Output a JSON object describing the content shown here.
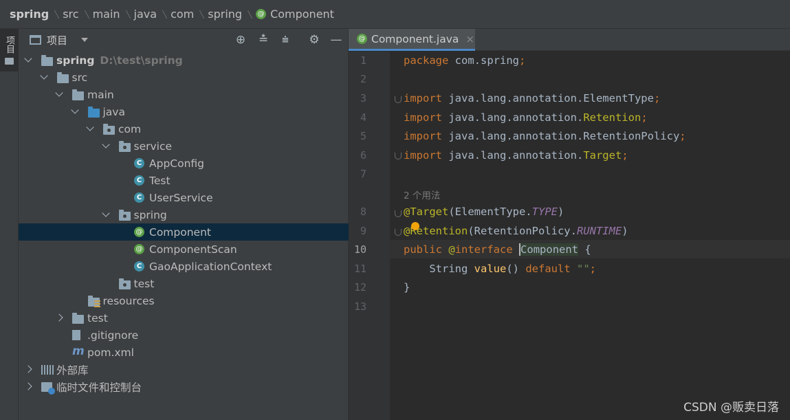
{
  "breadcrumb": [
    {
      "label": "spring",
      "bold": true
    },
    {
      "label": "src"
    },
    {
      "label": "main"
    },
    {
      "label": "java"
    },
    {
      "label": "com"
    },
    {
      "label": "spring"
    },
    {
      "label": "Component",
      "icon": "annotation-icon"
    }
  ],
  "left_strip": {
    "project_tab": "项目"
  },
  "panel": {
    "title": "项目",
    "toolbar": [
      "locate-icon",
      "expand-all-icon",
      "collapse-all-icon",
      "gear-icon",
      "hide-icon"
    ]
  },
  "tree": [
    {
      "label": "spring",
      "path": "D:\\test\\spring",
      "depth": 0,
      "arrow": "down",
      "icon": "module-folder-icon",
      "bold": true
    },
    {
      "label": "src",
      "depth": 1,
      "arrow": "down",
      "icon": "folder-icon"
    },
    {
      "label": "main",
      "depth": 2,
      "arrow": "down",
      "icon": "folder-icon"
    },
    {
      "label": "java",
      "depth": 3,
      "arrow": "down",
      "icon": "source-folder-icon"
    },
    {
      "label": "com",
      "depth": 4,
      "arrow": "down",
      "icon": "package-icon"
    },
    {
      "label": "service",
      "depth": 5,
      "arrow": "down",
      "icon": "package-icon"
    },
    {
      "label": "AppConfig",
      "depth": 6,
      "icon": "class-icon"
    },
    {
      "label": "Test",
      "depth": 6,
      "icon": "class-icon"
    },
    {
      "label": "UserService",
      "depth": 6,
      "icon": "class-icon"
    },
    {
      "label": "spring",
      "depth": 5,
      "arrow": "down",
      "icon": "package-icon"
    },
    {
      "label": "Component",
      "depth": 6,
      "icon": "annotation-icon",
      "selected": true
    },
    {
      "label": "ComponentScan",
      "depth": 6,
      "icon": "annotation-icon"
    },
    {
      "label": "GaoApplicationContext",
      "depth": 6,
      "icon": "class-icon"
    },
    {
      "label": "test",
      "depth": 5,
      "icon": "package-icon"
    },
    {
      "label": "resources",
      "depth": 3,
      "icon": "resources-folder-icon"
    },
    {
      "label": "test",
      "depth": 2,
      "arrow": "right",
      "icon": "folder-icon"
    },
    {
      "label": ".gitignore",
      "depth": 2,
      "icon": "file-icon"
    },
    {
      "label": "pom.xml",
      "depth": 2,
      "icon": "maven-icon"
    },
    {
      "label": "外部库",
      "depth": 0,
      "arrow": "right",
      "icon": "library-icon"
    },
    {
      "label": "临时文件和控制台",
      "depth": 0,
      "arrow": "right",
      "icon": "scratch-icon"
    }
  ],
  "editor": {
    "tab": {
      "label": "Component.java",
      "close": "×"
    },
    "usage_hint": "2 个用法",
    "line_numbers": [
      "1",
      "2",
      "3",
      "4",
      "5",
      "6",
      "7",
      "8",
      "9",
      "10",
      "11",
      "12",
      "13"
    ],
    "current_line": "10"
  },
  "watermark": "CSDN @贩卖日落",
  "colors": {
    "keyword": "#cc7832",
    "annotation": "#bbb529",
    "constant": "#9876aa",
    "string": "#6a8759",
    "selection": "#0d293e",
    "tab_underline": "#4a88c7"
  }
}
